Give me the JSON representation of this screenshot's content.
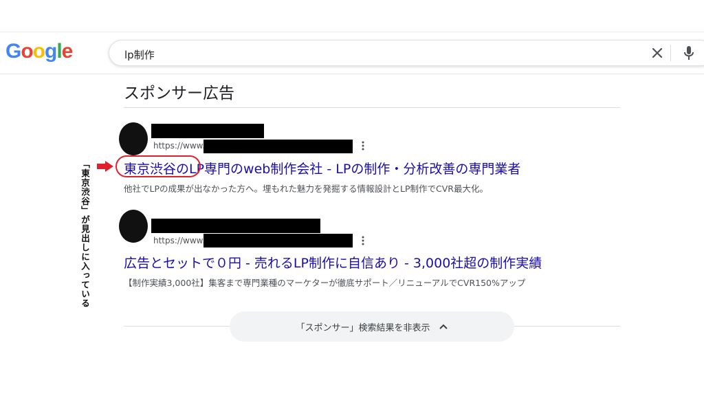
{
  "logo": {
    "letters": [
      "G",
      "o",
      "o",
      "g",
      "l",
      "e"
    ]
  },
  "search": {
    "query": "lp制作"
  },
  "icons": {
    "clear": "close-icon",
    "mic": "microphone-icon",
    "menu": "more-vert-icon",
    "arrow": "right-arrow-icon",
    "chevron": "chevron-up-icon"
  },
  "section": {
    "title": "スポンサー広告"
  },
  "ads": [
    {
      "url_prefix": "https://www.",
      "title_highlight": "東京渋谷の",
      "title_rest": "LP専門のweb制作会社 - LPの制作・分析改善の専門業者",
      "description": "他社でLPの成果が出なかった方へ。埋もれた魅力を発掘する情報設計とLP制作でCVR最大化。"
    },
    {
      "url_prefix": "https://www.",
      "title": "広告とセットで０円 - 売れるLP制作に自信あり - 3,000社超の制作実績",
      "description": "【制作実績3,000社】集客まで専門業種のマーケターが徹底サポート／リニューアルでCVR150%アップ"
    }
  ],
  "annotation": {
    "text": "「東京渋谷」が見出しに入っている"
  },
  "hide_button": {
    "label": "「スポンサー」検索結果を非表示"
  },
  "colors": {
    "link": "#1a0dab",
    "highlight": "#e0202c",
    "text": "#202124",
    "muted": "#4d5156"
  }
}
